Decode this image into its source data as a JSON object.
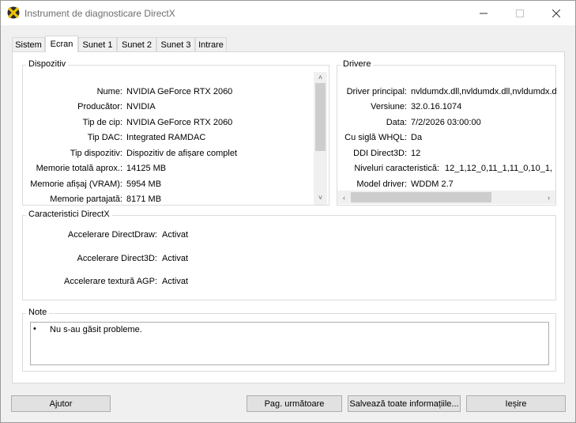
{
  "window": {
    "title": "Instrument de diagnosticare DirectX"
  },
  "tabs": [
    {
      "label": "Sistem"
    },
    {
      "label": "Ecran"
    },
    {
      "label": "Sunet 1"
    },
    {
      "label": "Sunet 2"
    },
    {
      "label": "Sunet 3"
    },
    {
      "label": "Intrare"
    }
  ],
  "device": {
    "title": "Dispozitiv",
    "rows": [
      {
        "label": "Nume:",
        "value": "NVIDIA GeForce RTX 2060"
      },
      {
        "label": "Producător:",
        "value": "NVIDIA"
      },
      {
        "label": "Tip de cip:",
        "value": "NVIDIA GeForce RTX 2060"
      },
      {
        "label": "Tip DAC:",
        "value": "Integrated RAMDAC"
      },
      {
        "label": "Tip dispozitiv:",
        "value": "Dispozitiv de afișare complet"
      },
      {
        "label": "Memorie totală aprox.:",
        "value": "14125 MB"
      },
      {
        "label": "Memorie afișaj (VRAM):",
        "value": "5954 MB"
      },
      {
        "label": "Memorie partajată:",
        "value": "8171 MB"
      }
    ]
  },
  "drivers": {
    "title": "Drivere",
    "rows": [
      {
        "label": "Driver principal:",
        "value": "nvldumdx.dll,nvldumdx.dll,nvldumdx.d"
      },
      {
        "label": "Versiune:",
        "value": "32.0.16.1074"
      },
      {
        "label": "Data:",
        "value": "7/2/2026 03:00:00"
      },
      {
        "label": "Cu siglă WHQL:",
        "value": "Da"
      },
      {
        "label": "DDI Direct3D:",
        "value": "12"
      },
      {
        "label": "Niveluri caracteristică:",
        "value": "12_1,12_0,11_1,11_0,10_1,"
      },
      {
        "label": "Model driver:",
        "value": "WDDM 2.7"
      }
    ]
  },
  "features": {
    "title": "Caracteristici DirectX",
    "rows": [
      {
        "label": "Accelerare DirectDraw:",
        "value": "Activat"
      },
      {
        "label": "Accelerare Direct3D:",
        "value": "Activat"
      },
      {
        "label": "Accelerare textură AGP:",
        "value": "Activat"
      }
    ]
  },
  "notes": {
    "title": "Note",
    "items": [
      {
        "bullet": "•",
        "text": "Nu s-au găsit probleme."
      }
    ]
  },
  "buttons": {
    "help": "Ajutor",
    "next": "Pag. următoare",
    "save": "Salvează toate informațiile...",
    "exit": "Ieșire"
  },
  "icons": {
    "app": "directx-icon",
    "minimize": "minimize-icon",
    "maximize": "maximize-icon",
    "close": "close-icon"
  }
}
